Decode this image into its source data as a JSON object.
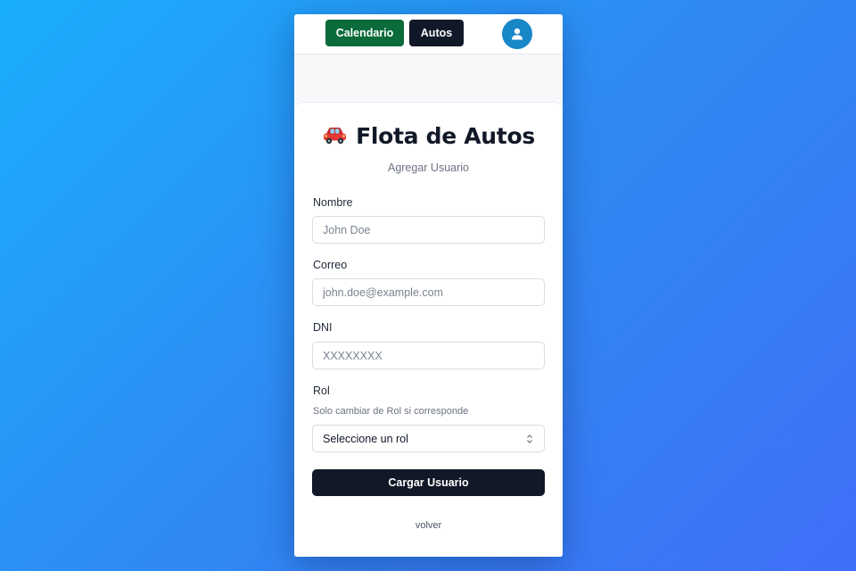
{
  "navbar": {
    "calendario_label": "Calendario",
    "autos_label": "Autos",
    "user_icon": "user-icon"
  },
  "card": {
    "title_icon": "car-icon",
    "title": "Flota de Autos",
    "subtitle": "Agregar Usuario"
  },
  "form": {
    "nombre": {
      "label": "Nombre",
      "placeholder": "John Doe",
      "value": ""
    },
    "correo": {
      "label": "Correo",
      "placeholder": "john.doe@example.com",
      "value": ""
    },
    "dni": {
      "label": "DNI",
      "placeholder": "XXXXXXXX",
      "value": ""
    },
    "rol": {
      "label": "Rol",
      "help": "Solo cambiar de Rol si corresponde",
      "selected": "Seleccione un rol"
    },
    "submit_label": "Cargar Usuario",
    "back_label": "volver"
  },
  "colors": {
    "calendario_button": "#0b6b3a",
    "primary_dark": "#111827",
    "avatar": "#1787c7",
    "background_gradient_start": "#1aaefc",
    "background_gradient_end": "#3f6ff8"
  }
}
